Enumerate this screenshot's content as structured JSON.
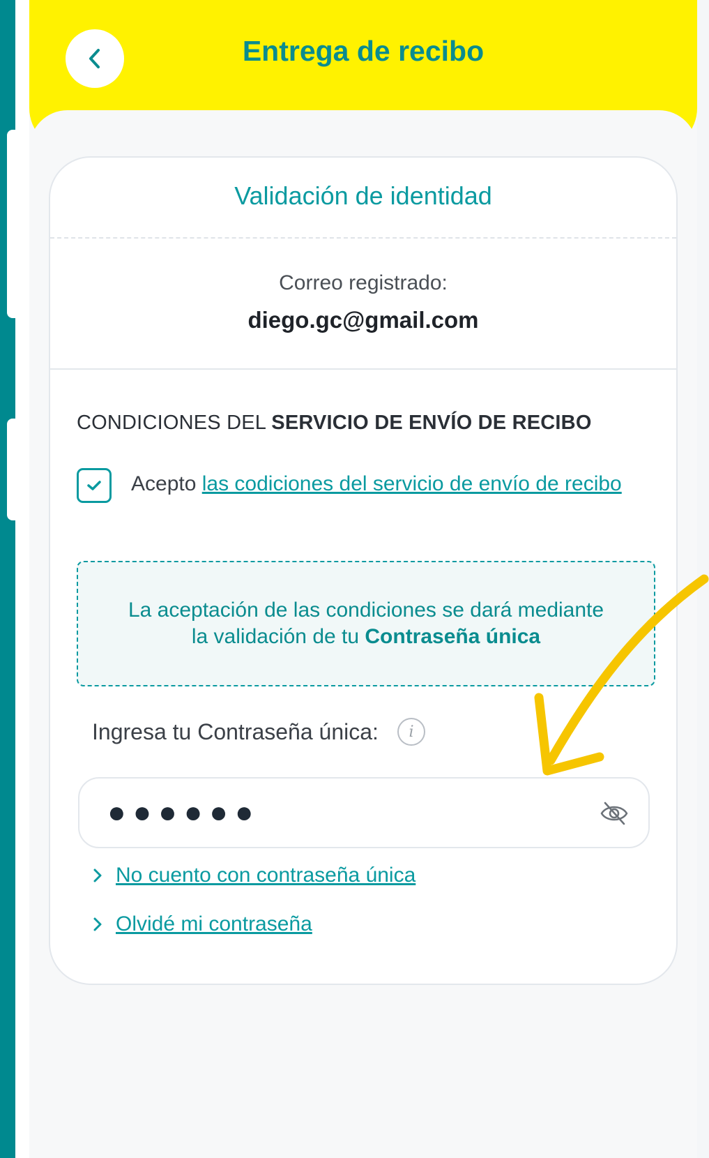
{
  "header": {
    "title": "Entrega de recibo"
  },
  "card": {
    "title": "Validación de identidad",
    "email_label": "Correo registrado:",
    "email_value": "diego.gc@gmail.com",
    "conditions_prefix": "CONDICIONES DEL ",
    "conditions_bold": "SERVICIO DE ENVÍO DE RECIBO",
    "accept_prefix": "Acepto ",
    "accept_link": "las codiciones del servicio de envío de recibo",
    "accept_checked": true,
    "notice_line1": "La aceptación de las condiciones se dará mediante",
    "notice_line2_prefix": "la validación de tu ",
    "notice_line2_bold": "Contraseña única",
    "password_label": "Ingresa tu Contraseña única:",
    "info_glyph": "i",
    "password_mask": "●●●●●●",
    "links": [
      {
        "label": "No cuento con contraseña única"
      },
      {
        "label": "Olvidé mi contraseña"
      }
    ]
  },
  "colors": {
    "teal": "#0a9aa0",
    "yellow": "#fff200",
    "annotation": "#f6c500"
  },
  "icons": {
    "back": "chevron-left-icon",
    "check": "check-icon",
    "info": "info-icon",
    "eye": "eye-off-icon",
    "link": "chevron-right-icon"
  }
}
